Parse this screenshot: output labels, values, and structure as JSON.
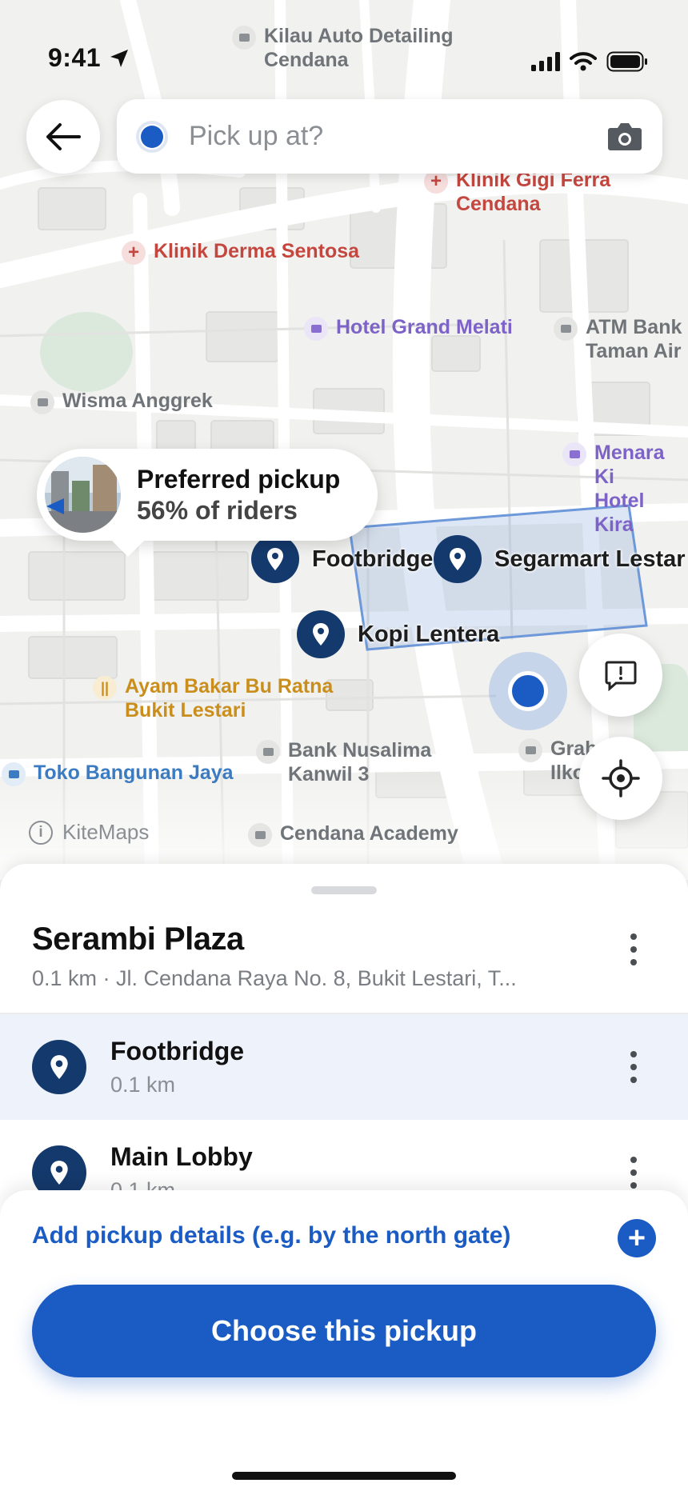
{
  "status_bar": {
    "time": "9:41"
  },
  "search": {
    "placeholder": "Pick up at?"
  },
  "map": {
    "pois": [
      {
        "key": "kilau",
        "name": "Kilau Auto Detailing\nCendana",
        "type": "grey"
      },
      {
        "key": "gigi",
        "name": "Klinik Gigi Ferra\nCendana",
        "type": "red"
      },
      {
        "key": "derma",
        "name": "Klinik Derma Sentosa",
        "type": "red"
      },
      {
        "key": "hotel-grand",
        "name": "Hotel Grand Melati",
        "type": "purple"
      },
      {
        "key": "atm",
        "name": "ATM Bank\nTaman Air",
        "type": "grey"
      },
      {
        "key": "wisma",
        "name": "Wisma Anggrek",
        "type": "grey"
      },
      {
        "key": "menara",
        "name": "Menara Ki\nHotel Kira",
        "type": "purple"
      },
      {
        "key": "ayam",
        "name": "Ayam Bakar Bu Ratna\nBukit Lestari",
        "type": "orange"
      },
      {
        "key": "bank",
        "name": "Bank Nusalima\nKanwil 3",
        "type": "grey"
      },
      {
        "key": "toko",
        "name": "Toko Bangunan Jaya",
        "type": "blue"
      },
      {
        "key": "grab",
        "name": "Grab  atel\nIlko",
        "type": "grey"
      },
      {
        "key": "academy",
        "name": "Cendana Academy",
        "type": "grey"
      }
    ],
    "attribution": "KiteMaps",
    "pins": [
      "Footbridge",
      "Segarmart Lestar",
      "Kopi Lentera"
    ]
  },
  "preferred": {
    "title": "Preferred pickup",
    "subtitle": "56% of riders"
  },
  "sheet": {
    "place_name": "Serambi Plaza",
    "place_address": "0.1 km · Jl. Cendana Raya No. 8, Bukit Lestari, T...",
    "options": [
      {
        "name": "Footbridge",
        "distance": "0.1 km",
        "selected": true
      },
      {
        "name": "Main Lobby",
        "distance": "0.1 km",
        "selected": false
      }
    ],
    "add_details": "Add pickup details (e.g. by the north gate)",
    "cta": "Choose this pickup"
  },
  "colors": {
    "accent": "#1a5bc4",
    "pin": "#14396c",
    "selected_row": "#edf2fb"
  }
}
